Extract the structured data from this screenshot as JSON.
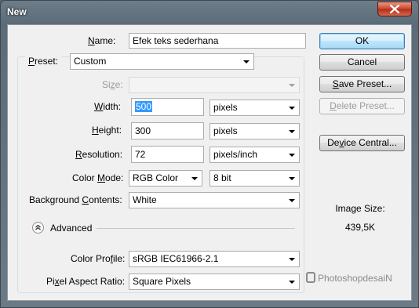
{
  "window": {
    "title": "New"
  },
  "fields": {
    "name": {
      "label_pre": "",
      "label_key": "N",
      "label_post": "ame:",
      "value": "Efek teks sederhana"
    },
    "preset": {
      "label_pre": "",
      "label_key": "P",
      "label_post": "reset:",
      "value": "Custom"
    },
    "size": {
      "label_pre": "Si",
      "label_key": "z",
      "label_post": "e:",
      "value": ""
    },
    "width": {
      "label_pre": "",
      "label_key": "W",
      "label_post": "idth:",
      "value": "500",
      "unit": "pixels"
    },
    "height": {
      "label_pre": "",
      "label_key": "H",
      "label_post": "eight:",
      "value": "300",
      "unit": "pixels"
    },
    "resolution": {
      "label_pre": "",
      "label_key": "R",
      "label_post": "esolution:",
      "value": "72",
      "unit": "pixels/inch"
    },
    "color_mode": {
      "label_pre": "Color ",
      "label_key": "M",
      "label_post": "ode:",
      "value": "RGB Color",
      "depth": "8 bit"
    },
    "background": {
      "label_pre": "Background ",
      "label_key": "C",
      "label_post": "ontents:",
      "value": "White"
    },
    "advanced": {
      "label": "Advanced"
    },
    "color_profile": {
      "label_pre": "Color Pro",
      "label_key": "f",
      "label_post": "ile:",
      "value": "sRGB IEC61966-2.1"
    },
    "pixel_aspect": {
      "label_pre": "Pi",
      "label_key": "x",
      "label_post": "el Aspect Ratio:",
      "value": "Square Pixels"
    }
  },
  "buttons": {
    "ok": "OK",
    "cancel": "Cancel",
    "save_preset_pre": "",
    "save_preset_key": "S",
    "save_preset_post": "ave Preset...",
    "delete_preset_pre": "",
    "delete_preset_key": "D",
    "delete_preset_post": "elete Preset...",
    "device_central_pre": "De",
    "device_central_key": "v",
    "device_central_post": "ice Central..."
  },
  "image_size": {
    "label": "Image Size:",
    "value": "439,5K"
  },
  "watermark": {
    "text": "PhotoshopdesaiN"
  },
  "icons": {
    "close": "close-icon",
    "advanced_toggle": "chevron-up-icon",
    "dropdown": "chevron-down-icon"
  },
  "colors": {
    "title_bar": "#5b6b78",
    "close_button": "#c9452c",
    "selection": "#3399ff",
    "default_button": "#3c7fb1"
  }
}
